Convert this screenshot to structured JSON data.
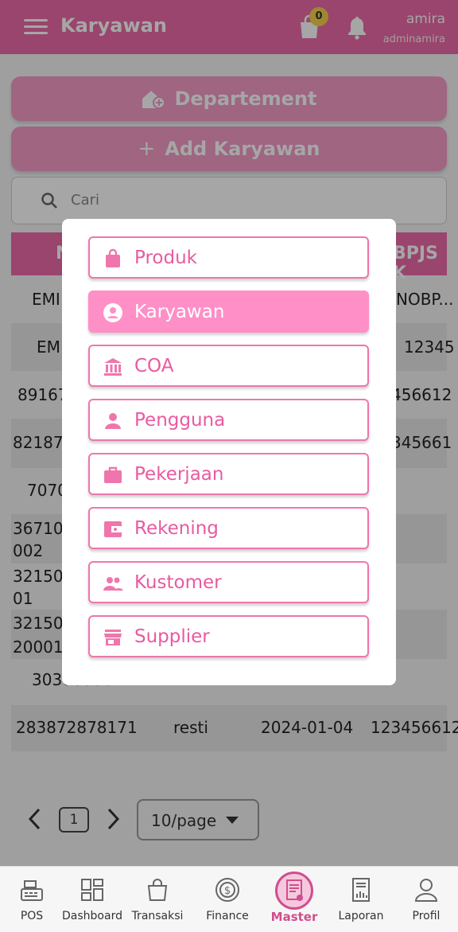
{
  "header": {
    "title": "Karyawan",
    "cart_count": "0",
    "user_name": "amira",
    "user_role": "adminamira"
  },
  "actions": {
    "departement_label": "Departement",
    "add_karyawan_label": "Add Karyawan"
  },
  "search": {
    "placeholder": "Cari"
  },
  "table": {
    "visible_header_left": "N",
    "visible_header_right": "BPJS K",
    "rows": [
      {
        "c1": "EMI",
        "c2": "",
        "c3": "",
        "c4": "NOBP..."
      },
      {
        "c1": "EM",
        "c2": "",
        "c3": "",
        "c4": "12345"
      },
      {
        "c1": "89167",
        "c2": "",
        "c3": "",
        "c4": "456612"
      },
      {
        "c1": "821872",
        "c2": "",
        "c3": "",
        "c4": "345661"
      },
      {
        "c1": "7070",
        "c2": "",
        "c3": "",
        "c4": ""
      },
      {
        "c1": "367101\n002",
        "c2": "",
        "c3": "",
        "c4": ""
      },
      {
        "c1": "32150\n01",
        "c2": "",
        "c3": "",
        "c4": ""
      },
      {
        "c1": "32150\n20001",
        "c2": "",
        "c3": "",
        "c4": ""
      },
      {
        "c1": "30300000",
        "c2": "",
        "c3": "",
        "c4": ""
      },
      {
        "c1": "283872878171",
        "c2": "resti",
        "c3": "2024-01-04",
        "c4": "123456612"
      }
    ]
  },
  "pagination": {
    "current_page": "1",
    "per_page": "10/page"
  },
  "menu": {
    "items": [
      {
        "label": "Produk",
        "icon": "shopping-bag-icon",
        "selected": false
      },
      {
        "label": "Karyawan",
        "icon": "account-circle-icon",
        "selected": true
      },
      {
        "label": "COA",
        "icon": "bank-icon",
        "selected": false
      },
      {
        "label": "Pengguna",
        "icon": "person-icon",
        "selected": false
      },
      {
        "label": "Pekerjaan",
        "icon": "briefcase-icon",
        "selected": false
      },
      {
        "label": "Rekening",
        "icon": "wallet-icon",
        "selected": false
      },
      {
        "label": "Kustomer",
        "icon": "people-icon",
        "selected": false
      },
      {
        "label": "Supplier",
        "icon": "store-icon",
        "selected": false
      }
    ]
  },
  "bottom_nav": {
    "items": [
      {
        "label": "POS",
        "icon": "cash-register-icon"
      },
      {
        "label": "Dashboard",
        "icon": "dashboard-icon"
      },
      {
        "label": "Transaksi",
        "icon": "shopping-bag-icon"
      },
      {
        "label": "Finance",
        "icon": "dollar-coin-icon"
      },
      {
        "label": "Master",
        "icon": "document-settings-icon",
        "active": true
      },
      {
        "label": "Laporan",
        "icon": "report-icon"
      },
      {
        "label": "Profil",
        "icon": "user-icon"
      }
    ]
  },
  "colors": {
    "primary": "#ec6aa8",
    "accent_light": "#f49bc7",
    "selected_item": "#ff8fc7",
    "badge": "#f4d24a"
  }
}
